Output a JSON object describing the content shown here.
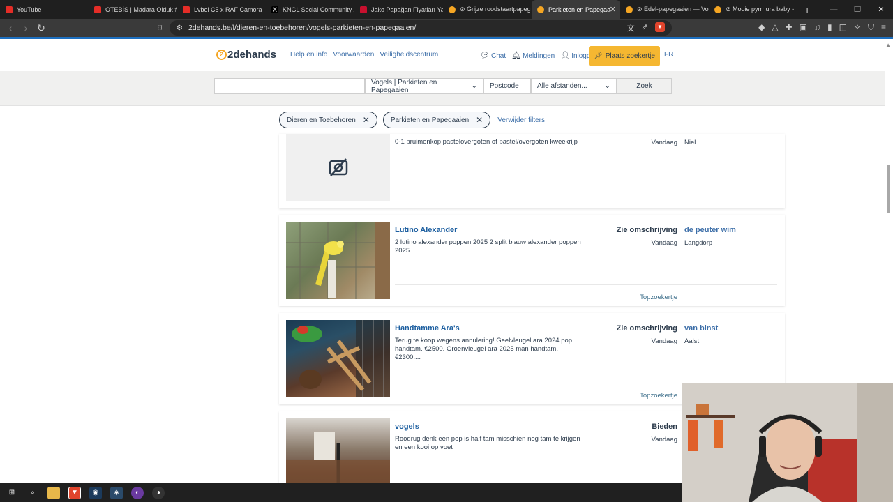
{
  "browser": {
    "tabs": [
      {
        "title": "YouTube",
        "color": "#e52d27"
      },
      {
        "title": "OTEBİS | Madara Olduk #b",
        "color": "#e52d27"
      },
      {
        "title": "Lvbel C5 x RAF Camora",
        "color": "#e52d27"
      },
      {
        "title": "KNGL Social Community /",
        "color": "#000000"
      },
      {
        "title": "Jako Papağan Fiyatları Yav",
        "color": "#c8102e"
      },
      {
        "title": "⊘ Grijze roodstaartpapeg",
        "color": "#f5a623"
      },
      {
        "title": "Parkieten en Papegaa",
        "color": "#f5a623"
      },
      {
        "title": "⊘ Edel-papegaaien — Vo",
        "color": "#f5a623"
      },
      {
        "title": "⊘ Mooie pyrrhura baby -",
        "color": "#f5a623"
      }
    ],
    "url": "2dehands.be/l/dieren-en-toebehoren/vogels-parkieten-en-papegaaien/"
  },
  "site": {
    "logo": "2dehands",
    "nav": [
      "Help en info",
      "Voorwaarden",
      "Veiligheidscentrum"
    ],
    "chat": "Chat",
    "notifications": "Meldingen",
    "login": "Inloggen",
    "place_ad": "Plaats zoekertje",
    "lang": "FR"
  },
  "search": {
    "query": "",
    "category": "Vogels | Parkieten en Papegaaien",
    "postcode_placeholder": "Postcode",
    "distance": "Alle afstanden...",
    "submit": "Zoek"
  },
  "filters": {
    "chips": [
      "Dieren en Toebehoren",
      "Parkieten en Papegaaien"
    ],
    "clear": "Verwijder filters"
  },
  "listings": [
    {
      "title": "",
      "desc": "0-1 pruimenkop pastelovergoten of pastel/overgoten kweekrijp",
      "price": "",
      "date": "Vandaag",
      "seller": "",
      "location": "Niel",
      "tag": ""
    },
    {
      "title": "Lutino Alexander",
      "desc": "2 lutino alexander poppen 2025 2 split blauw alexander poppen 2025",
      "price": "Zie omschrijving",
      "date": "Vandaag",
      "seller": "de peuter wim",
      "location": "Langdorp",
      "tag": "Topzoekertje"
    },
    {
      "title": "Handtamme Ara's",
      "desc": "Terug te koop wegens annulering! Geelvleugel ara 2024 pop handtam. €2500. Groenvleugel ara 2025 man handtam. €2300....",
      "price": "Zie omschrijving",
      "date": "Vandaag",
      "seller": "van binst",
      "location": "Aalst",
      "tag": "Topzoekertje"
    },
    {
      "title": "vogels",
      "desc": "Roodrug denk een pop is half tam misschien nog tam te krijgen en een kooi op voet",
      "price": "Bieden",
      "date": "Vandaag",
      "seller": "",
      "location": "",
      "tag": ""
    }
  ]
}
